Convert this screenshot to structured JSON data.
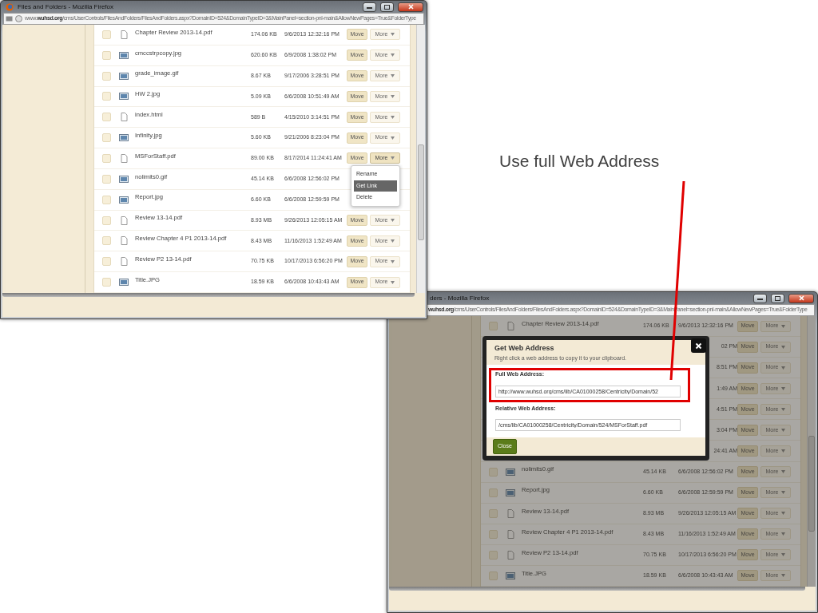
{
  "caption": "Use full Web Address",
  "windows": [
    {
      "title": "Files and Folders - Mozilla Firefox",
      "url_prefix": "www.",
      "url_host": "wuhsd.org",
      "url_path": "/cms/UserControls/FilesAndFolders/FilesAndFolders.aspx?DomainID=524&DomainTypeID=3&MainPanel=section-pnl-main&AllowNewPages=True&FolderType",
      "rows": [
        {
          "kind": "file",
          "checked": false,
          "name": "Chapter Review 2013-14.pdf",
          "size": "174.06 KB",
          "date": "9/6/2013 12:32:16 PM",
          "move": "Move",
          "more": "More",
          "more_open": false
        },
        {
          "kind": "image",
          "checked": false,
          "name": "cmccstrpcopy.jpg",
          "size": "620.60 KB",
          "date": "6/9/2008 1:38:02 PM",
          "move": "Move",
          "more": "More",
          "more_open": false
        },
        {
          "kind": "image",
          "checked": false,
          "name": "grade_image.gif",
          "size": "8.67 KB",
          "date": "9/17/2006 3:28:51 PM",
          "move": "Move",
          "more": "More",
          "more_open": false
        },
        {
          "kind": "image",
          "checked": false,
          "name": "HW 2.jpg",
          "size": "5.09 KB",
          "date": "6/6/2008 10:51:49 AM",
          "move": "Move",
          "more": "More",
          "more_open": false
        },
        {
          "kind": "file",
          "checked": false,
          "name": "index.html",
          "size": "589 B",
          "date": "4/15/2010 3:14:51 PM",
          "move": "Move",
          "more": "More",
          "more_open": false
        },
        {
          "kind": "image",
          "checked": false,
          "name": "Infinity.jpg",
          "size": "5.60 KB",
          "date": "9/21/2006 8:23:04 PM",
          "move": "Move",
          "more": "More",
          "more_open": false
        },
        {
          "kind": "file",
          "checked": false,
          "name": "MSForStaff.pdf",
          "size": "89.00 KB",
          "date": "8/17/2014 11:24:41 AM",
          "move": "Move",
          "more": "More",
          "more_open": true,
          "menu": {
            "items": [
              {
                "label": "Rename",
                "selected": false
              },
              {
                "label": "Get Link",
                "selected": true
              },
              {
                "label": "Delete",
                "selected": false
              }
            ]
          }
        },
        {
          "kind": "image",
          "checked": false,
          "name": "nolimits0.gif",
          "size": "45.14 KB",
          "date": "6/6/2008 12:56:02 PM"
        },
        {
          "kind": "image",
          "checked": false,
          "name": "Report.jpg",
          "size": "6.60 KB",
          "date": "6/6/2008 12:59:59 PM"
        },
        {
          "kind": "file",
          "checked": false,
          "name": "Review 13-14.pdf",
          "size": "8.93 MB",
          "date": "9/26/2013 12:05:15 AM",
          "move": "Move",
          "more": "More",
          "more_open": false
        },
        {
          "kind": "file",
          "checked": false,
          "name": "Review Chapter 4 P1 2013-14.pdf",
          "size": "8.43 MB",
          "date": "11/16/2013 1:52:49 AM",
          "move": "Move",
          "more": "More",
          "more_open": false
        },
        {
          "kind": "file",
          "checked": false,
          "name": "Review P2 13-14.pdf",
          "size": "70.75 KB",
          "date": "10/17/2013 6:56:20 PM",
          "move": "Move",
          "more": "More",
          "more_open": false
        },
        {
          "kind": "image",
          "checked": false,
          "name": "Title.JPG",
          "size": "18.59 KB",
          "date": "6/6/2008 10:43:43 AM",
          "move": "Move",
          "more": "More",
          "more_open": false
        }
      ]
    },
    {
      "title": "ders - Mozilla Firefox",
      "url_host": "wuhsd.org",
      "url_path": "/cms/UserControls/FilesAndFolders/FilesAndFolders.aspx?DomainID=524&DomainTypeID=3&MainPanel=section-pnl-main&AllowNewPages=True&FolderType",
      "rows": [
        {
          "kind": "file",
          "checked": false,
          "name": "Chapter Review 2013-14.pdf",
          "size": "174.06 KB",
          "date": "9/6/2013 12:32:16 PM",
          "move": "Move",
          "more": "More",
          "more_open": false
        },
        {
          "date": "02 PM",
          "move": "Move",
          "more": "More",
          "more_open": false
        },
        {
          "date": "8:51 PM",
          "move": "Move",
          "more": "More",
          "more_open": false
        },
        {
          "date": "1:49 AM",
          "move": "Move",
          "more": "More",
          "more_open": false
        },
        {
          "date": "4:51 PM",
          "move": "Move",
          "more": "More",
          "more_open": false
        },
        {
          "date": "3:04 PM",
          "move": "Move",
          "more": "More",
          "more_open": false
        },
        {
          "date": "24:41 AM",
          "move": "Move",
          "more": "More",
          "more_open": false
        },
        {
          "kind": "image",
          "checked": false,
          "name": "nolimits0.gif",
          "size": "45.14 KB",
          "date": "6/6/2008 12:56:02 PM",
          "move": "Move",
          "more": "More",
          "more_open": false
        },
        {
          "kind": "image",
          "checked": false,
          "name": "Report.jpg",
          "size": "6.60 KB",
          "date": "6/6/2008 12:59:59 PM",
          "move": "Move",
          "more": "More",
          "more_open": false
        },
        {
          "kind": "file",
          "checked": false,
          "name": "Review 13-14.pdf",
          "size": "8.93 MB",
          "date": "9/26/2013 12:05:15 AM",
          "move": "Move",
          "more": "More",
          "more_open": false
        },
        {
          "kind": "file",
          "checked": false,
          "name": "Review Chapter 4 P1 2013-14.pdf",
          "size": "8.43 MB",
          "date": "11/16/2013 1:52:49 AM",
          "move": "Move",
          "more": "More",
          "more_open": false
        },
        {
          "kind": "file",
          "checked": false,
          "name": "Review P2 13-14.pdf",
          "size": "70.75 KB",
          "date": "10/17/2013 6:56:20 PM",
          "move": "Move",
          "more": "More",
          "more_open": false
        },
        {
          "kind": "image",
          "checked": false,
          "name": "Title.JPG",
          "size": "18.59 KB",
          "date": "6/6/2008 10:43:43 AM",
          "move": "Move",
          "more": "More",
          "more_open": false
        }
      ],
      "modal": {
        "title": "Get Web Address",
        "subtitle": "Right click a web address to copy it to your clipboard.",
        "fields": [
          {
            "label": "Full Web Address:",
            "value": "http://www.wuhsd.org/cms/lib/CA01000258/Centricity/Domain/52",
            "highlighted": true
          },
          {
            "label": "Relative Web Address:",
            "value": "/cms/lib/CA01000258/Centricity/Domain/524/MSForStaff.pdf",
            "highlighted": false
          }
        ],
        "button": "Close"
      }
    }
  ]
}
